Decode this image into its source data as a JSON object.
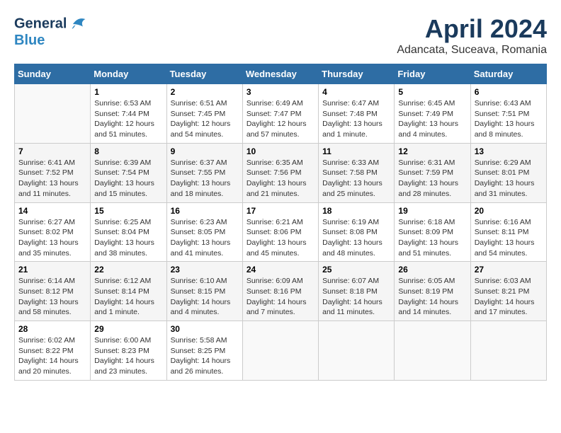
{
  "header": {
    "logo_line1": "General",
    "logo_line2": "Blue",
    "title": "April 2024",
    "subtitle": "Adancata, Suceava, Romania"
  },
  "weekdays": [
    "Sunday",
    "Monday",
    "Tuesday",
    "Wednesday",
    "Thursday",
    "Friday",
    "Saturday"
  ],
  "weeks": [
    [
      {
        "day": "",
        "sunrise": "",
        "sunset": "",
        "daylight": ""
      },
      {
        "day": "1",
        "sunrise": "Sunrise: 6:53 AM",
        "sunset": "Sunset: 7:44 PM",
        "daylight": "Daylight: 12 hours and 51 minutes."
      },
      {
        "day": "2",
        "sunrise": "Sunrise: 6:51 AM",
        "sunset": "Sunset: 7:45 PM",
        "daylight": "Daylight: 12 hours and 54 minutes."
      },
      {
        "day": "3",
        "sunrise": "Sunrise: 6:49 AM",
        "sunset": "Sunset: 7:47 PM",
        "daylight": "Daylight: 12 hours and 57 minutes."
      },
      {
        "day": "4",
        "sunrise": "Sunrise: 6:47 AM",
        "sunset": "Sunset: 7:48 PM",
        "daylight": "Daylight: 13 hours and 1 minute."
      },
      {
        "day": "5",
        "sunrise": "Sunrise: 6:45 AM",
        "sunset": "Sunset: 7:49 PM",
        "daylight": "Daylight: 13 hours and 4 minutes."
      },
      {
        "day": "6",
        "sunrise": "Sunrise: 6:43 AM",
        "sunset": "Sunset: 7:51 PM",
        "daylight": "Daylight: 13 hours and 8 minutes."
      }
    ],
    [
      {
        "day": "7",
        "sunrise": "Sunrise: 6:41 AM",
        "sunset": "Sunset: 7:52 PM",
        "daylight": "Daylight: 13 hours and 11 minutes."
      },
      {
        "day": "8",
        "sunrise": "Sunrise: 6:39 AM",
        "sunset": "Sunset: 7:54 PM",
        "daylight": "Daylight: 13 hours and 15 minutes."
      },
      {
        "day": "9",
        "sunrise": "Sunrise: 6:37 AM",
        "sunset": "Sunset: 7:55 PM",
        "daylight": "Daylight: 13 hours and 18 minutes."
      },
      {
        "day": "10",
        "sunrise": "Sunrise: 6:35 AM",
        "sunset": "Sunset: 7:56 PM",
        "daylight": "Daylight: 13 hours and 21 minutes."
      },
      {
        "day": "11",
        "sunrise": "Sunrise: 6:33 AM",
        "sunset": "Sunset: 7:58 PM",
        "daylight": "Daylight: 13 hours and 25 minutes."
      },
      {
        "day": "12",
        "sunrise": "Sunrise: 6:31 AM",
        "sunset": "Sunset: 7:59 PM",
        "daylight": "Daylight: 13 hours and 28 minutes."
      },
      {
        "day": "13",
        "sunrise": "Sunrise: 6:29 AM",
        "sunset": "Sunset: 8:01 PM",
        "daylight": "Daylight: 13 hours and 31 minutes."
      }
    ],
    [
      {
        "day": "14",
        "sunrise": "Sunrise: 6:27 AM",
        "sunset": "Sunset: 8:02 PM",
        "daylight": "Daylight: 13 hours and 35 minutes."
      },
      {
        "day": "15",
        "sunrise": "Sunrise: 6:25 AM",
        "sunset": "Sunset: 8:04 PM",
        "daylight": "Daylight: 13 hours and 38 minutes."
      },
      {
        "day": "16",
        "sunrise": "Sunrise: 6:23 AM",
        "sunset": "Sunset: 8:05 PM",
        "daylight": "Daylight: 13 hours and 41 minutes."
      },
      {
        "day": "17",
        "sunrise": "Sunrise: 6:21 AM",
        "sunset": "Sunset: 8:06 PM",
        "daylight": "Daylight: 13 hours and 45 minutes."
      },
      {
        "day": "18",
        "sunrise": "Sunrise: 6:19 AM",
        "sunset": "Sunset: 8:08 PM",
        "daylight": "Daylight: 13 hours and 48 minutes."
      },
      {
        "day": "19",
        "sunrise": "Sunrise: 6:18 AM",
        "sunset": "Sunset: 8:09 PM",
        "daylight": "Daylight: 13 hours and 51 minutes."
      },
      {
        "day": "20",
        "sunrise": "Sunrise: 6:16 AM",
        "sunset": "Sunset: 8:11 PM",
        "daylight": "Daylight: 13 hours and 54 minutes."
      }
    ],
    [
      {
        "day": "21",
        "sunrise": "Sunrise: 6:14 AM",
        "sunset": "Sunset: 8:12 PM",
        "daylight": "Daylight: 13 hours and 58 minutes."
      },
      {
        "day": "22",
        "sunrise": "Sunrise: 6:12 AM",
        "sunset": "Sunset: 8:14 PM",
        "daylight": "Daylight: 14 hours and 1 minute."
      },
      {
        "day": "23",
        "sunrise": "Sunrise: 6:10 AM",
        "sunset": "Sunset: 8:15 PM",
        "daylight": "Daylight: 14 hours and 4 minutes."
      },
      {
        "day": "24",
        "sunrise": "Sunrise: 6:09 AM",
        "sunset": "Sunset: 8:16 PM",
        "daylight": "Daylight: 14 hours and 7 minutes."
      },
      {
        "day": "25",
        "sunrise": "Sunrise: 6:07 AM",
        "sunset": "Sunset: 8:18 PM",
        "daylight": "Daylight: 14 hours and 11 minutes."
      },
      {
        "day": "26",
        "sunrise": "Sunrise: 6:05 AM",
        "sunset": "Sunset: 8:19 PM",
        "daylight": "Daylight: 14 hours and 14 minutes."
      },
      {
        "day": "27",
        "sunrise": "Sunrise: 6:03 AM",
        "sunset": "Sunset: 8:21 PM",
        "daylight": "Daylight: 14 hours and 17 minutes."
      }
    ],
    [
      {
        "day": "28",
        "sunrise": "Sunrise: 6:02 AM",
        "sunset": "Sunset: 8:22 PM",
        "daylight": "Daylight: 14 hours and 20 minutes."
      },
      {
        "day": "29",
        "sunrise": "Sunrise: 6:00 AM",
        "sunset": "Sunset: 8:23 PM",
        "daylight": "Daylight: 14 hours and 23 minutes."
      },
      {
        "day": "30",
        "sunrise": "Sunrise: 5:58 AM",
        "sunset": "Sunset: 8:25 PM",
        "daylight": "Daylight: 14 hours and 26 minutes."
      },
      {
        "day": "",
        "sunrise": "",
        "sunset": "",
        "daylight": ""
      },
      {
        "day": "",
        "sunrise": "",
        "sunset": "",
        "daylight": ""
      },
      {
        "day": "",
        "sunrise": "",
        "sunset": "",
        "daylight": ""
      },
      {
        "day": "",
        "sunrise": "",
        "sunset": "",
        "daylight": ""
      }
    ]
  ]
}
